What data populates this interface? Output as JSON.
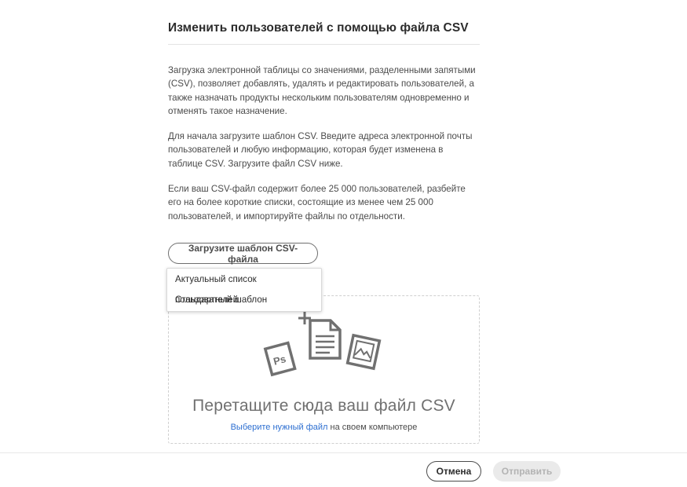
{
  "dialog": {
    "title": "Изменить пользователей с помощью файла CSV",
    "paragraphs": [
      "Загрузка электронной таблицы со значениями, разделенными запятыми (CSV), позволяет добавлять, удалять и редактировать пользователей, а также назначать продукты нескольким пользователям одновременно и отменять такое назначение.",
      "Для начала загрузите шаблон CSV. Введите адреса электронной почты пользователей и любую информацию, которая будет изменена в таблице CSV. Загрузите файл CSV ниже.",
      "Если ваш CSV-файл содержит более 25 000 пользователей, разбейте его на более короткие списки, состоящие из менее чем 25 000 пользователей, и импортируйте файлы по отдельности."
    ],
    "template_button": "Загрузите шаблон CSV-файла",
    "template_menu": [
      "Актуальный список пользователей",
      "Стандартный шаблон"
    ],
    "dropzone": {
      "title": "Перетащите сюда ваш файл CSV",
      "link": "Выберите нужный файл",
      "suffix": " на своем компьютере",
      "icons": [
        "photoshop-file-icon",
        "add-document-icon",
        "image-file-icon"
      ],
      "ps_label": "Ps"
    }
  },
  "footer": {
    "cancel": "Отмена",
    "submit": "Отправить"
  },
  "colors": {
    "link": "#2d6fd1",
    "text": "#2c2c2c",
    "icon": "#707070",
    "disabled_bg": "#eaeaea",
    "disabled_text": "#b3b3b3"
  }
}
